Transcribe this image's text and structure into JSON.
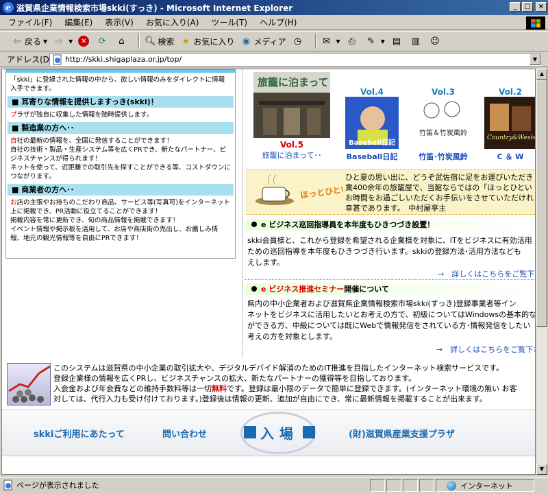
{
  "window": {
    "title": "滋賀県企業情報検索市場skki(すっき) - Microsoft Internet Explorer",
    "min": "_",
    "max": "□",
    "close": "×"
  },
  "menu": [
    "ファイル(F)",
    "編集(E)",
    "表示(V)",
    "お気に入り(A)",
    "ツール(T)",
    "ヘルプ(H)"
  ],
  "toolbar": {
    "back": "戻る",
    "search": "検索",
    "favorites": "お気に入り",
    "media": "メディア"
  },
  "address": {
    "label": "アドレス(D)",
    "url": "http://skki.shigaplaza.or.jp/top/"
  },
  "left": {
    "intro": "「skki」に登録された情報の中から、欲しい情報のみをダイレクトに情報入手できます。",
    "sections": [
      {
        "head": "■ 耳寄りな情報を提供しますっき(skki)！",
        "lines": [
          {
            "lead": "プ",
            "rest": "ラザが独自に収集した情報を随時提供します。"
          }
        ]
      },
      {
        "head": "■ 製造業の方へ･･",
        "lines": [
          {
            "lead": "自",
            "rest": "社の最新の情報を、全国に発信することができます！"
          },
          {
            "lead": "",
            "rest": "自社の技術・製品・生産システム等を広くPRでき、新たなパートナー、ビジネスチャンスが得られます！"
          },
          {
            "lead": "",
            "rest": "ネットを使って、近距離での取引先を探すことができる等、コストダウンにつながります。"
          }
        ]
      },
      {
        "head": "■ 商業者の方へ･･",
        "lines": [
          {
            "lead": "お",
            "rest": "店の主張やお持ちのこだわり商品、サービス等(写真可)をインターネット上に掲載でき、PR活動に役立てることができます！"
          },
          {
            "lead": "",
            "rest": "掲載内容を常に更新でき、旬の商品情報を掲載できます！"
          },
          {
            "lead": "",
            "rest": "イベント情報や掲示板を活用して、お店や商店街の売出し、お薦しみ情報、地元の観光情報等を自由にPRできます！"
          }
        ]
      }
    ]
  },
  "vols": [
    {
      "vol": "Vol.5",
      "caption": "旅籠に泊まって･･",
      "img_text": "旅籠に泊まって"
    },
    {
      "vol": "Vol.4",
      "caption": "Baseball日記",
      "img_text": "Baseball日記"
    },
    {
      "vol": "Vol.3",
      "caption": "竹笛･竹炭風鈴",
      "img_text": "竹笛＆竹炭風鈴"
    },
    {
      "vol": "Vol.2",
      "caption": "C ＆ W",
      "img_text": "Country&Western"
    }
  ],
  "hot": {
    "banner": "ほっとひといき･･",
    "lines": [
      "ひと夏の思い出に、どうぞ武佐宿に足をお運びいただき",
      "業400余年の旅籠屋で、当館ならではの「ほっとひとい",
      "お時間をお過ごしいただくお手伝いをさせていただけれ",
      "幸甚であります。　中村屋亭主"
    ]
  },
  "news": [
    {
      "title_pre": "e ビジネス巡回指導員を本年度もひきつづき設置！",
      "title_red": "",
      "title_post": "",
      "lines": [
        "skki会員様と、これから登録を希望される企業様を対象に、ITをビジネスに有効活用",
        "ための巡回指導を本年度もひきつづき行います。skkiの登録方法･活用方法なども",
        "えします。"
      ],
      "more": "→　詳しくはこちらをご覧下さ"
    },
    {
      "title_pre": "",
      "title_red": "e ビジネス推進セミナー",
      "title_post": "開催について",
      "lines": [
        "県内の中小企業者および滋賀県企業情報検索市場skki(すっき)登録事業者等イン",
        "ネットをビジネスに活用したいとお考えの方で、初級についてはWindowsの基本的な",
        "ができる方、中級については既にWebで情報発信をされている方･情報発信をしたい",
        "考えの方を対象とします。"
      ],
      "more": "→　詳しくはこちらをご覧下さい"
    }
  ],
  "info": {
    "line1": "このシステムは滋賀県の中小企業の取引拡大や、デジタルデバイド解消のためのIT推進を目指したインターネット検索サービスです。",
    "line2": "登録企業様の情報を広くPRし、ビジネスチャンスの拡大、新たなパートナーの獲得等を目指しております。",
    "line3_pre": "入会金および年会費などの維持手数料等は一切",
    "line3_red": "無料",
    "line3_post": "です。登録は最小限のデータで簡単に登録できます。(インターネット環境の無い お客",
    "line4": "対しては、代行入力も受け付けております。)登録後は情報の更新、追加が自由にでき、常に最新情報を掲載することが出来ます。"
  },
  "footer": {
    "usage": "skkiご利用にあたって",
    "contact": "問い合わせ",
    "enter": "入場",
    "plaza": "(財)滋賀県産業支援プラザ"
  },
  "status": {
    "text": "ページが表示されました",
    "zone": "インターネット"
  }
}
